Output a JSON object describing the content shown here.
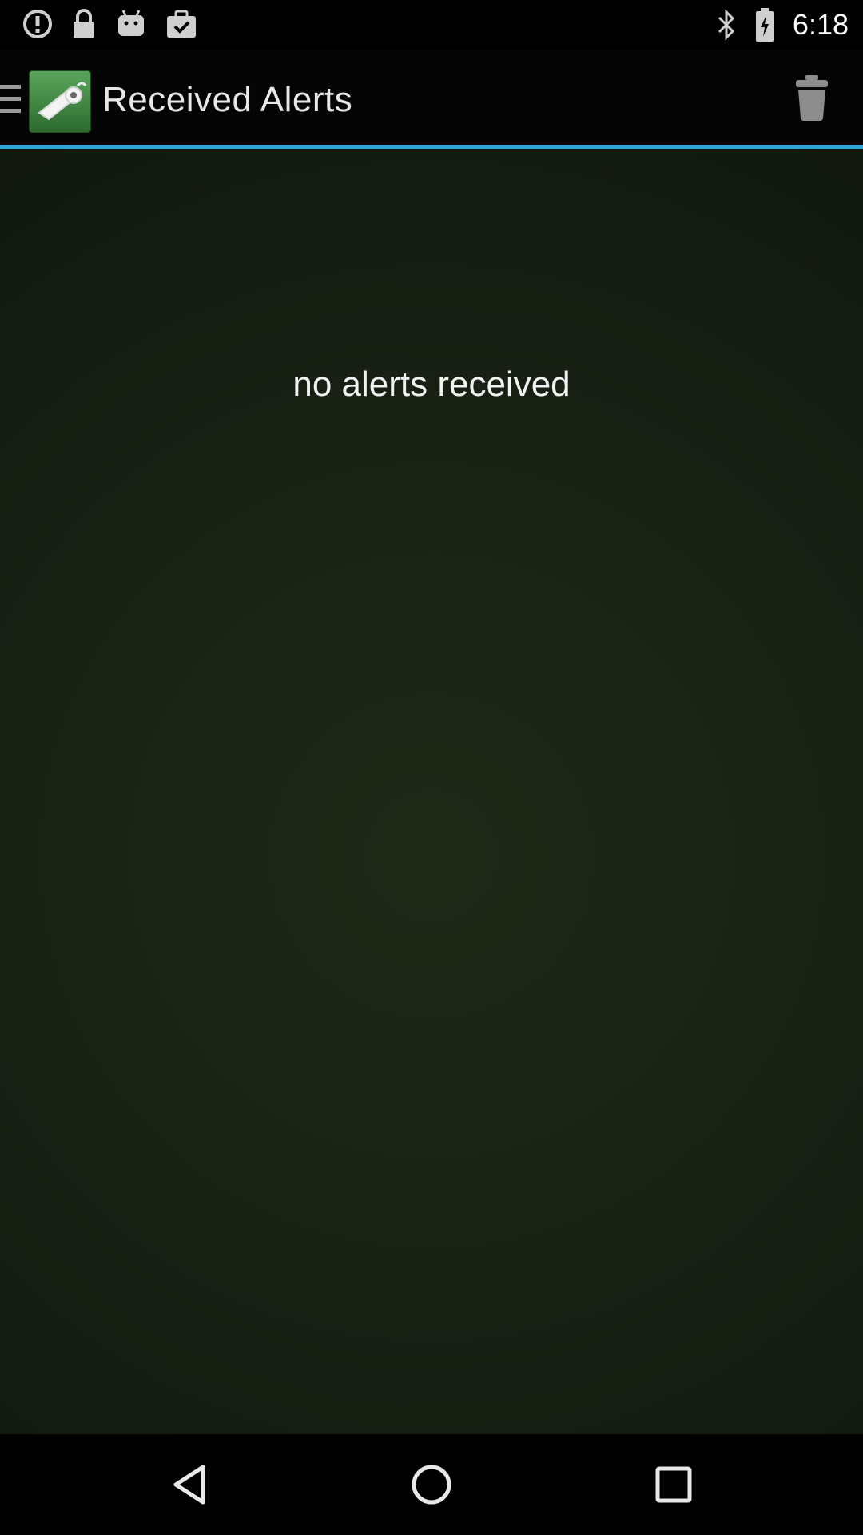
{
  "status_bar": {
    "time": "6:18",
    "icons": [
      "alert-circle-icon",
      "lock-icon",
      "android-icon",
      "briefcase-check-icon",
      "bluetooth-icon",
      "battery-charging-icon"
    ]
  },
  "action_bar": {
    "title": "Received Alerts",
    "app_icon": "whistle-icon",
    "actions": [
      "trash-icon"
    ],
    "accent_color": "#2aa7d8"
  },
  "content": {
    "empty_message": "no alerts received",
    "background_color": "#1a2214"
  },
  "nav_bar": {
    "buttons": [
      "back-icon",
      "home-icon",
      "recents-icon"
    ]
  }
}
